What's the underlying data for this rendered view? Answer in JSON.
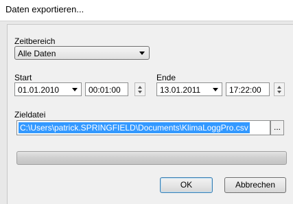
{
  "window": {
    "title": "Daten exportieren..."
  },
  "zeitbereich": {
    "label": "Zeitbereich",
    "selected": "Alle Daten"
  },
  "start": {
    "label": "Start",
    "date": "01.01.2010",
    "time": "00:01:00"
  },
  "ende": {
    "label": "Ende",
    "date": "13.01.2011",
    "time": "17:22:00"
  },
  "zieldatei": {
    "label": "Zieldatei",
    "path": "C:\\Users\\patrick.SPRINGFIELD\\Documents\\KlimaLoggPro.csv",
    "browse_label": "..."
  },
  "buttons": {
    "ok": "OK",
    "cancel": "Abbrechen"
  }
}
